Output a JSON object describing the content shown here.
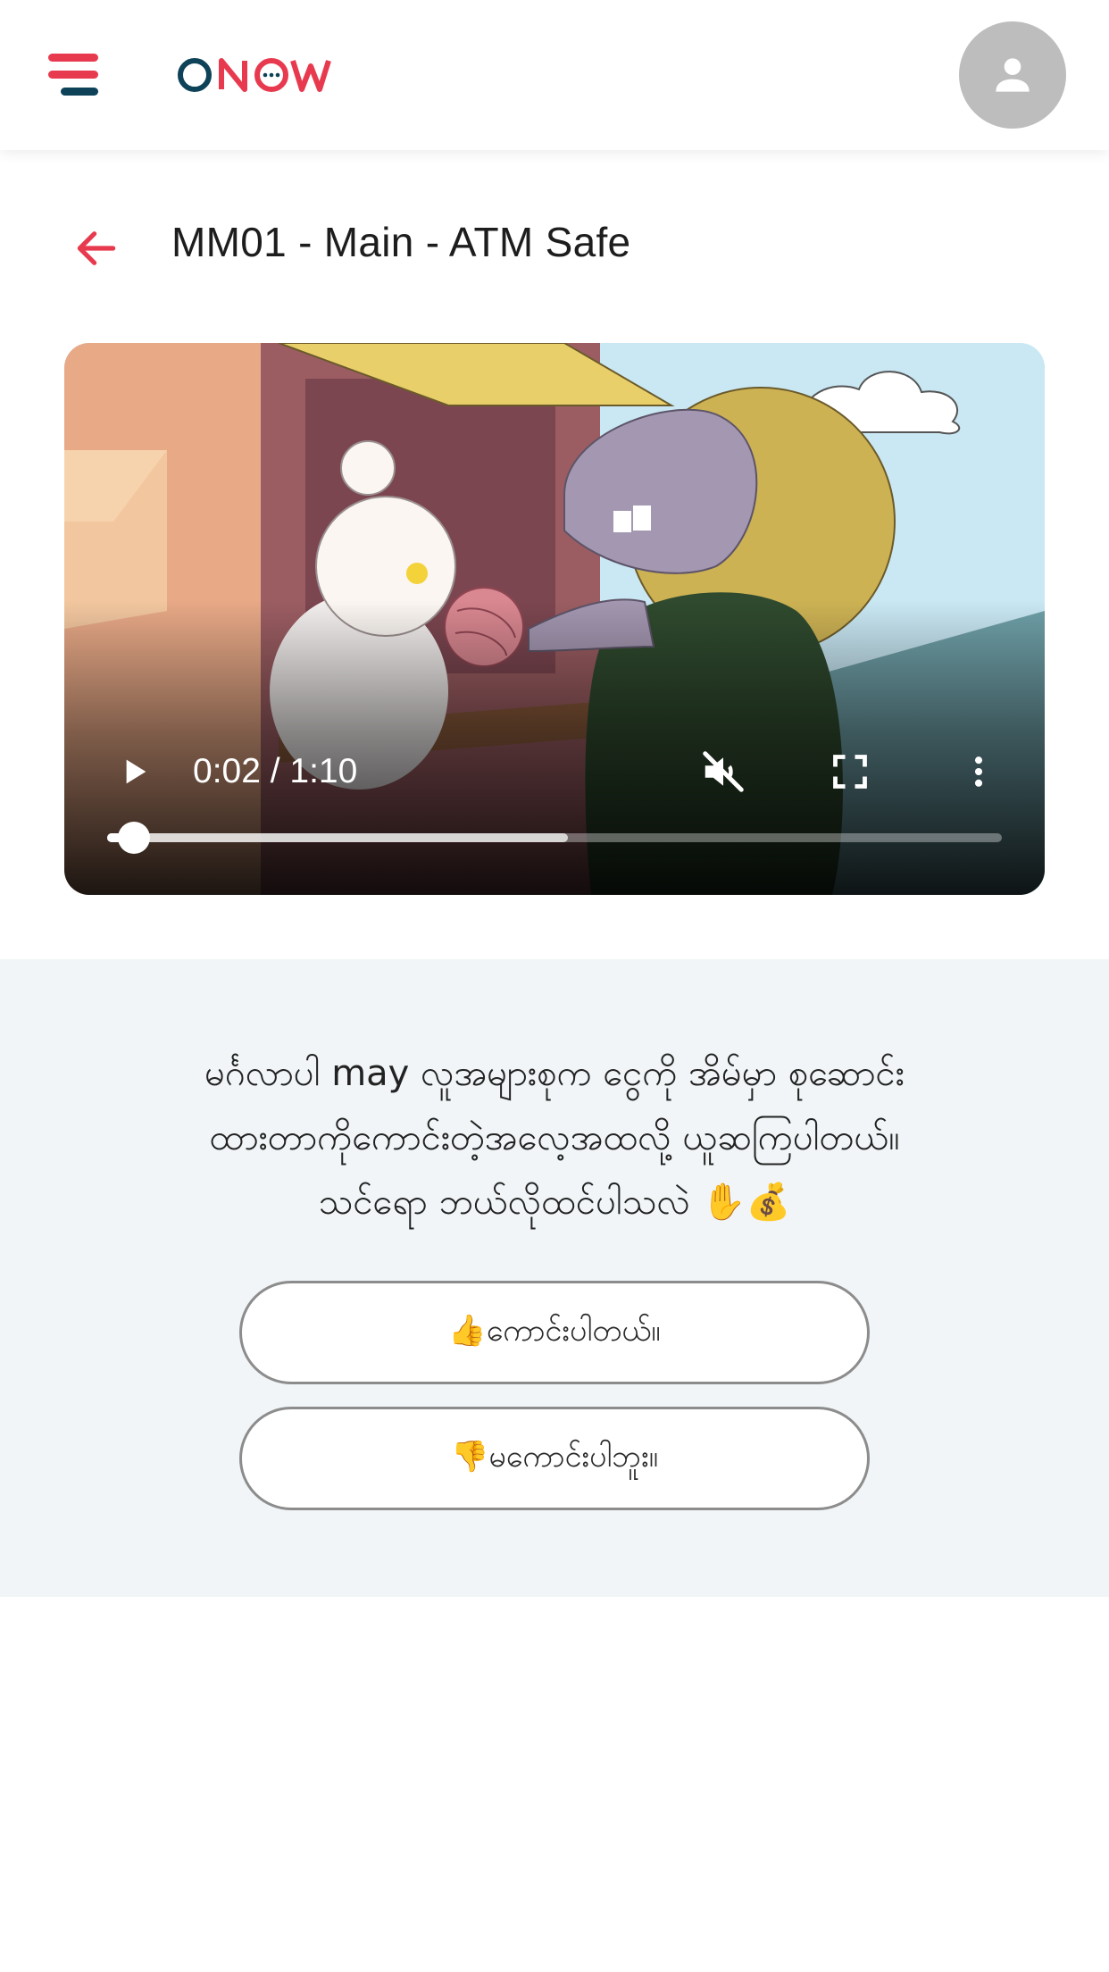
{
  "app": {
    "logo_text": "ONOW",
    "brand_color": "#e83a4f",
    "brand_dark": "#0e4258",
    "icons": {
      "menu": "menu-icon",
      "avatar": "person-icon",
      "back": "arrow-left-icon"
    }
  },
  "page": {
    "title": "MM01 - Main - ATM Safe"
  },
  "video": {
    "current_time": "0:02",
    "duration": "1:10",
    "time_display": "0:02 / 1:10",
    "played_fraction": 0.03,
    "buffered_fraction": 0.515,
    "muted": true,
    "controls": [
      "play-icon",
      "mute-icon",
      "fullscreen-icon",
      "more-vert-icon"
    ]
  },
  "question": {
    "line1": "မင်္ဂလာပါ may လူအများစုက ငွေကို အိမ်မှာ စုဆောင်း",
    "line2": "ထားတာကိုကောင်းတဲ့အလေ့အထလို့ ယူဆကြပါတယ်။",
    "line3": "သင်ရော ဘယ်လိုထင်ပါသလဲ ✋💰"
  },
  "answers": {
    "yes": "👍ကောင်းပါတယ်။",
    "no": "👎မကောင်းပါဘူး။"
  }
}
